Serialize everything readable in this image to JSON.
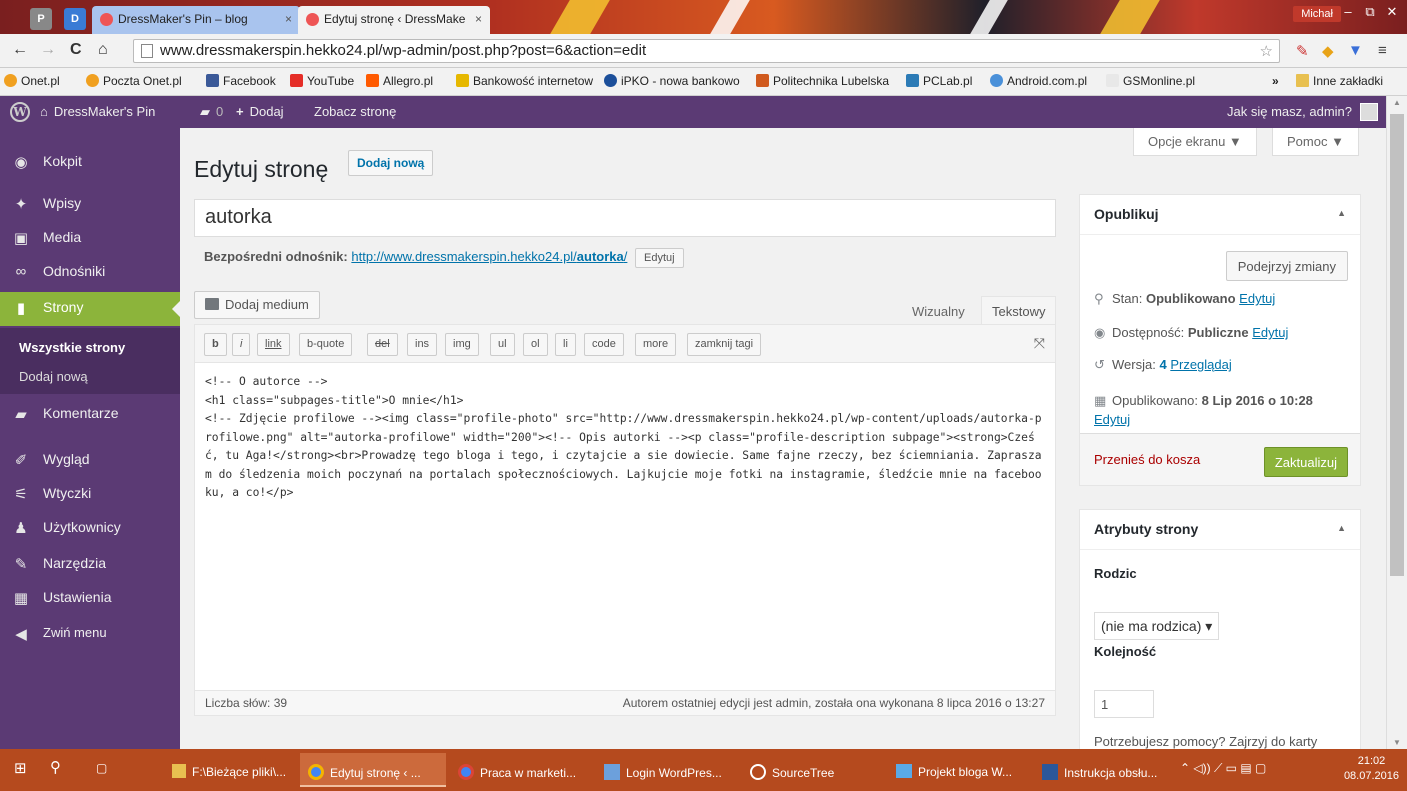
{
  "browser": {
    "tabs": [
      {
        "label": "DressMaker's Pin – blog",
        "close": "×"
      },
      {
        "label": "Edytuj stronę ‹ DressMake",
        "close": "×"
      }
    ],
    "mini_tabs": [
      "P",
      "D"
    ],
    "user_badge": "Michał",
    "window_buttons": [
      "–",
      "⧉",
      "✕"
    ],
    "url": "www.dressmakerspin.hekko24.pl/wp-admin/post.php?post=6&action=edit",
    "bookmarks": [
      "Onet.pl",
      "Poczta Onet.pl",
      "Facebook",
      "YouTube",
      "Allegro.pl",
      "Bankowość internetow",
      "iPKO - nowa bankowo",
      "Politechnika Lubelska",
      "PCLab.pl",
      "Android.com.pl",
      "GSMonline.pl",
      "»",
      "Inne zakładki"
    ]
  },
  "adminbar": {
    "site_name": "DressMaker's Pin",
    "comments_count": "0",
    "add_label": "Dodaj",
    "view_label": "Zobacz stronę",
    "greeting": "Jak się masz, admin?"
  },
  "sidebar": {
    "items": [
      {
        "label": "Kokpit",
        "icon": "dashboard-icon"
      },
      {
        "label": "Wpisy",
        "icon": "pin-icon"
      },
      {
        "label": "Media",
        "icon": "media-icon"
      },
      {
        "label": "Odnośniki",
        "icon": "link-icon"
      },
      {
        "label": "Strony",
        "icon": "page-icon"
      },
      {
        "label": "Komentarze",
        "icon": "comment-icon"
      },
      {
        "label": "Wygląd",
        "icon": "brush-icon"
      },
      {
        "label": "Wtyczki",
        "icon": "plugin-icon"
      },
      {
        "label": "Użytkownicy",
        "icon": "users-icon"
      },
      {
        "label": "Narzędzia",
        "icon": "wrench-icon"
      },
      {
        "label": "Ustawienia",
        "icon": "settings-icon"
      },
      {
        "label": "Zwiń menu",
        "icon": "collapse-icon"
      }
    ],
    "submenu": [
      "Wszystkie strony",
      "Dodaj nową"
    ]
  },
  "main": {
    "screen_options": "Opcje ekranu ▼",
    "help": "Pomoc ▼",
    "title": "Edytuj stronę",
    "add_new": "Dodaj nową",
    "post_title": "autorka",
    "permalink_label": "Bezpośredni odnośnik:",
    "permalink_base": "http://www.dressmakerspin.hekko24.pl/",
    "permalink_slug": "autorka",
    "permalink_trail": "/",
    "permalink_edit": "Edytuj",
    "add_media": "Dodaj medium",
    "tab_visual": "Wizualny",
    "tab_text": "Tekstowy",
    "quicktags": [
      "b",
      "i",
      "link",
      "b-quote",
      "del",
      "ins",
      "img",
      "ul",
      "ol",
      "li",
      "code",
      "more",
      "zamknij tagi"
    ],
    "content": "<!-- O autorce -->\n<h1 class=\"subpages-title\">O mnie</h1>\n<!-- Zdjęcie profilowe --><img class=\"profile-photo\" src=\"http://www.dressmakerspin.hekko24.pl/wp-content/uploads/autorka-profilowe.png\" alt=\"autorka-profilowe\" width=\"200\"><!-- Opis autorki --><p class=\"profile-description subpage\"><strong>Cześć, tu Aga!</strong><br>Prowadzę tego bloga i tego, i czytajcie a sie dowiecie. Same fajne rzeczy, bez ściemniania. Zapraszam do śledzenia moich poczynań na portalach społecznościowych. Lajkujcie moje fotki na instagramie, śledźcie mnie na facebooku, a co!</p>",
    "word_count": "Liczba słów: 39",
    "last_edit": "Autorem ostatniej edycji jest admin, została ona wykonana 8 lipca 2016 o 13:27"
  },
  "publish": {
    "title": "Opublikuj",
    "preview": "Podejrzyj zmiany",
    "status_label": "Stan:",
    "status_value": "Opublikowano",
    "visibility_label": "Dostępność:",
    "visibility_value": "Publiczne",
    "revisions_label": "Wersja:",
    "revisions_count": "4",
    "revisions_link": "Przeglądaj",
    "published_label": "Opublikowano:",
    "published_value": "8 Lip 2016 o 10:28",
    "edit_link": "Edytuj",
    "trash": "Przenieś do kosza",
    "update": "Zaktualizuj"
  },
  "attributes": {
    "title": "Atrybuty strony",
    "parent_label": "Rodzic",
    "parent_value": "(nie ma rodzica) ▾",
    "order_label": "Kolejność",
    "order_value": "1",
    "help": "Potrzebujesz pomocy? Zajrzyj do karty „Pomoc” znajdującej się w prawym"
  },
  "taskbar": {
    "items": [
      "F:\\Bieżące pliki\\...",
      "Edytuj stronę ‹ ...",
      "Praca w marketi...",
      "Login WordPres...",
      "SourceTree",
      "Projekt bloga W...",
      "Instrukcja obsłu..."
    ],
    "time": "21:02",
    "date": "08.07.2016"
  }
}
